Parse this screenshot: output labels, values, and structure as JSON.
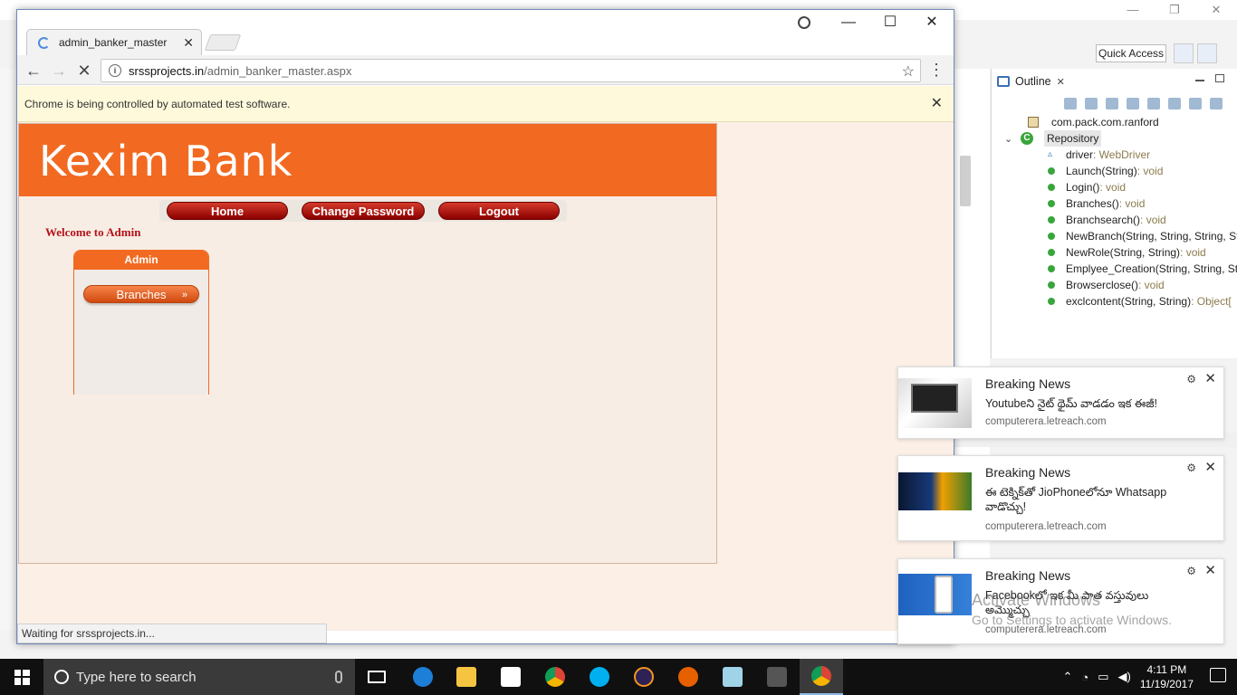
{
  "eclipse": {
    "quick_access": "Quick Access",
    "outline": {
      "tab_label": "Outline",
      "tree": [
        {
          "name": "com.pack.com.ranford",
          "type": "",
          "kind": "package"
        },
        {
          "name": "Repository",
          "type": "",
          "kind": "class"
        },
        {
          "name": "driver",
          "type": " : WebDriver",
          "kind": "field"
        },
        {
          "name": "Launch(String)",
          "type": " : void",
          "kind": "method"
        },
        {
          "name": "Login()",
          "type": " : void",
          "kind": "method"
        },
        {
          "name": "Branches()",
          "type": " : void",
          "kind": "method"
        },
        {
          "name": "Branchsearch()",
          "type": " : void",
          "kind": "method"
        },
        {
          "name": "NewBranch(String, String, String, St",
          "type": "",
          "kind": "method"
        },
        {
          "name": "NewRole(String, String)",
          "type": " : void",
          "kind": "method"
        },
        {
          "name": "Emplyee_Creation(String, String, St",
          "type": "",
          "kind": "method"
        },
        {
          "name": "Browserclose()",
          "type": " : void",
          "kind": "method"
        },
        {
          "name": "exclcontent(String, String)",
          "type": " : Object[",
          "kind": "method"
        }
      ]
    }
  },
  "chrome": {
    "tab_title": "admin_banker_master",
    "url_host": "srssprojects.in",
    "url_path": "/admin_banker_master.aspx",
    "infobar_message": "Chrome is being controlled by automated test software.",
    "status_text": "Waiting for srssprojects.in..."
  },
  "site": {
    "bank_name": "Kexim Bank",
    "nav": [
      "Home",
      "Change Password",
      "Logout"
    ],
    "welcome": "Welcome to Admin",
    "admin_box_title": "Admin",
    "branches_button": "Branches"
  },
  "notifications": [
    {
      "title": "Breaking News",
      "body": "Youtubeని నైట్ థైమ్ వాడడం ఇక ఈజీ!",
      "source": "computerera.letreach.com"
    },
    {
      "title": "Breaking News",
      "body": "ఈ టెక్నిక్‌తో JioPhoneలోనూ Whatsapp వాడొచ్చు!",
      "source": "computerera.letreach.com"
    },
    {
      "title": "Breaking News",
      "body": "Facebookలో ఇక మీ పాత వస్తువులు అమ్మొచ్చు",
      "source": "computerera.letreach.com"
    }
  ],
  "watermark": {
    "line1": "Activate Windows",
    "line2": "Go to Settings to activate Windows."
  },
  "taskbar": {
    "search_placeholder": "Type here to search",
    "time": "4:11 PM",
    "date": "11/19/2017"
  }
}
